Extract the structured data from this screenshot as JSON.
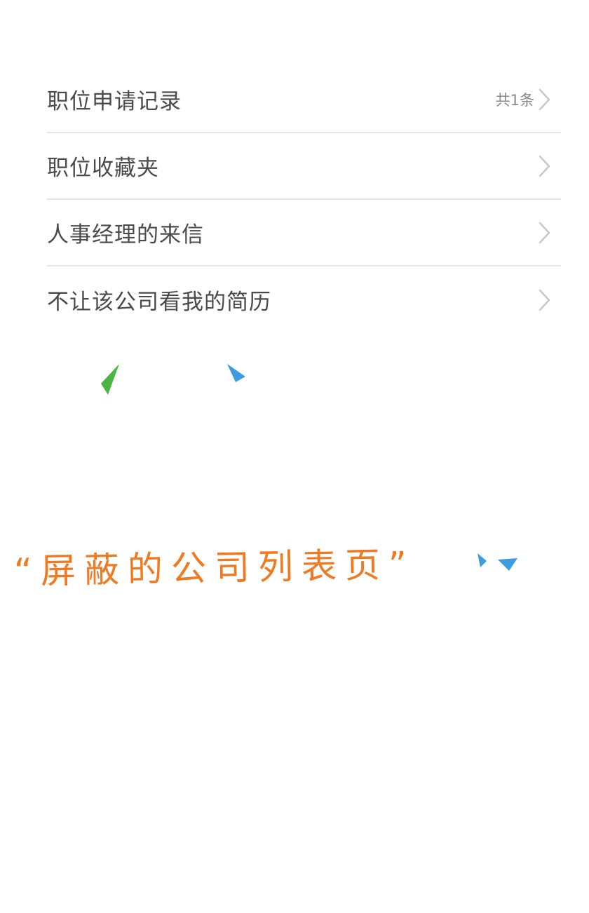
{
  "menu": {
    "items": [
      {
        "label": "职位申请记录",
        "count": "共1条"
      },
      {
        "label": "职位收藏夹",
        "count": ""
      },
      {
        "label": "人事经理的来信",
        "count": ""
      },
      {
        "label": "不让该公司看我的简历",
        "count": ""
      }
    ]
  },
  "annotation": {
    "text": "“屏蔽的公司列表页”"
  },
  "colors": {
    "label_text": "#4a4a4a",
    "count_text": "#8a8a8a",
    "divider": "#e6e6e6",
    "chevron": "#c8c8c8",
    "annotation": "#f07a22",
    "deco_green": "#4bb543",
    "deco_blue": "#3d9be0"
  },
  "icons": {
    "row_arrow": "chevron-right-icon"
  }
}
